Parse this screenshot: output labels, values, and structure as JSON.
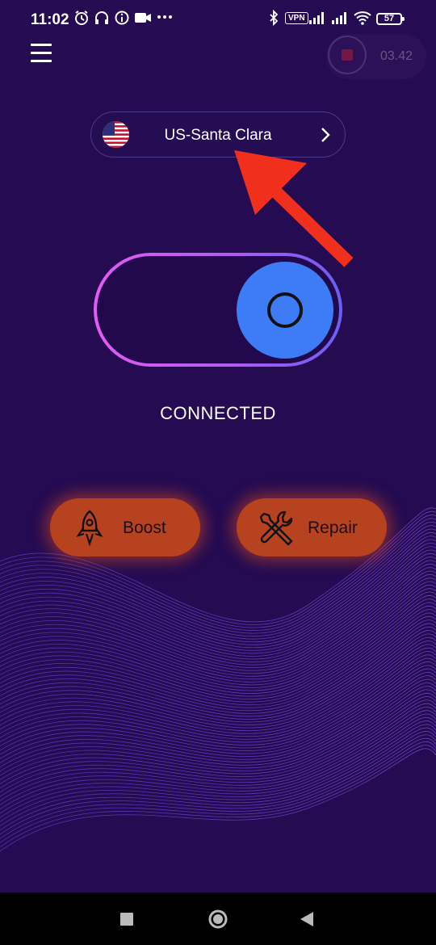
{
  "status_bar": {
    "time": "11:02",
    "vpn_label": "VPN",
    "battery": "57",
    "icons": [
      "alarm-icon",
      "headphones-icon",
      "info-icon",
      "video-icon",
      "more-icon",
      "bluetooth-icon",
      "signal-icon",
      "signal-icon",
      "wifi-icon",
      "battery-icon"
    ]
  },
  "recorder": {
    "time": "03.42"
  },
  "location": {
    "label": "US-Santa Clara",
    "flag": "us-flag-icon"
  },
  "connection": {
    "status": "CONNECTED",
    "connected": true
  },
  "actions": {
    "boost_label": "Boost",
    "repair_label": "Repair"
  },
  "colors": {
    "background": "#240b52",
    "toggle_gradient_start": "#e35bf0",
    "toggle_gradient_end": "#6b5ef2",
    "knob": "#3d7cf5",
    "action_button": "#b7421f",
    "annotation_arrow": "#f0301c"
  }
}
